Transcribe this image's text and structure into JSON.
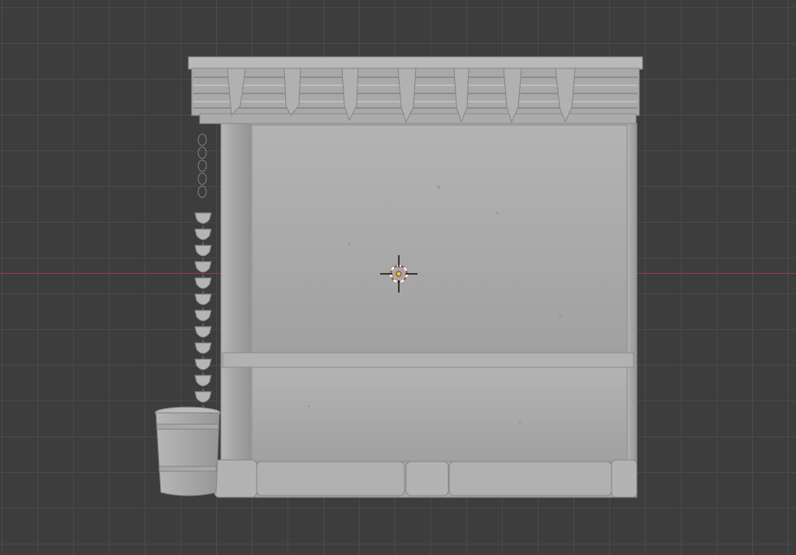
{
  "viewport": {
    "view": "front-orthographic",
    "background_color": "#3d3d3d",
    "grid_color": "#4a4a4a",
    "x_axis_color": "#9b3a44",
    "grid": true
  },
  "model": {
    "name": "stone-wall-with-awning-chain-and-bucket",
    "surface_color": "#a6a6a6"
  },
  "cursor": {
    "icon": "3d-cursor-icon",
    "colors": [
      "#ffffff",
      "#d04040"
    ]
  }
}
